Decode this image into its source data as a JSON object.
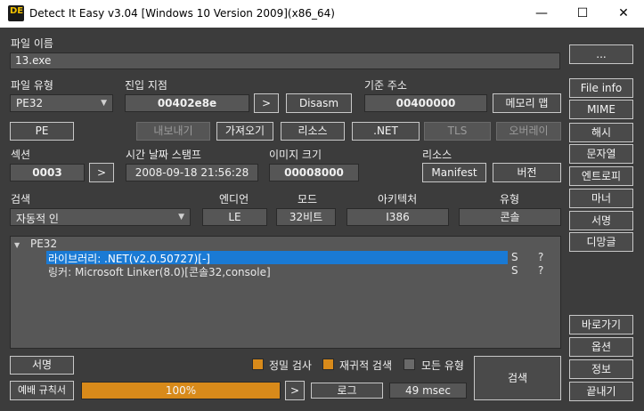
{
  "window": {
    "title": "Detect It Easy v3.04 [Windows 10 Version 2009](x86_64)",
    "icon_text": "DE",
    "minimize_glyph": "—",
    "maximize_glyph": "☐",
    "close_glyph": "✕"
  },
  "file_name": {
    "label": "파일 이름",
    "value": "13.exe",
    "browse": "..."
  },
  "file_type": {
    "label": "파일 유형",
    "value": "PE32",
    "pe_button": "PE"
  },
  "entry_point": {
    "label": "진입 지점",
    "value": "00402e8e",
    "go_button": ">",
    "disasm_button": "Disasm"
  },
  "base_address": {
    "label": "기준 주소",
    "value": "00400000",
    "memory_map_button": "메모리 맵"
  },
  "toolbar_row": {
    "export": "내보내기",
    "import": "가져오기",
    "resources": "리소스",
    "net": ".NET",
    "tls": "TLS",
    "overlay": "오버레이"
  },
  "section": {
    "label": "섹션",
    "value": "0003",
    "go_button": ">"
  },
  "timestamp": {
    "label": "시간 날짜 스탬프",
    "value": "2008-09-18 21:56:28"
  },
  "image_size": {
    "label": "이미지 크기",
    "value": "00008000"
  },
  "resource_group": {
    "label": "리소스",
    "manifest": "Manifest",
    "version": "버전"
  },
  "scan": {
    "label": "검색",
    "value": "자동적 인"
  },
  "endian": {
    "label": "엔디언",
    "value": "LE"
  },
  "mode": {
    "label": "모드",
    "value": "32비트"
  },
  "arch": {
    "label": "아키텍처",
    "value": "I386"
  },
  "type": {
    "label": "유형",
    "value": "콘솔"
  },
  "results": {
    "root": "PE32",
    "expand_glyph": "▼",
    "items": [
      {
        "text": "라이브러리: .NET(v2.0.50727)[-]",
        "flag": "S",
        "q": "?"
      },
      {
        "text": "링커: Microsoft Linker(8.0)[콘솔32,console]",
        "flag": "S",
        "q": "?"
      }
    ]
  },
  "right_panel": {
    "top": [
      "File info",
      "MIME",
      "해시",
      "문자열",
      "엔트로피",
      "마너",
      "서명",
      "디망글"
    ],
    "bottom": [
      "바로가기",
      "옵션",
      "정보",
      "끝내기"
    ]
  },
  "bottom": {
    "signatures": "서명",
    "heuristic_rules": "예배 규칙서",
    "deep_scan": "정밀 검사",
    "recursive_scan": "재귀적 검색",
    "all_types": "모든 유형",
    "progress_text": "100%",
    "progress": 1.0,
    "arrow": ">",
    "log": "로그",
    "time": "49 msec",
    "scan_button": "검색"
  },
  "colors": {
    "accent": "#d88a1a",
    "selection": "#1a7ad4",
    "background": "#3c3c3c",
    "field": "#565656"
  }
}
